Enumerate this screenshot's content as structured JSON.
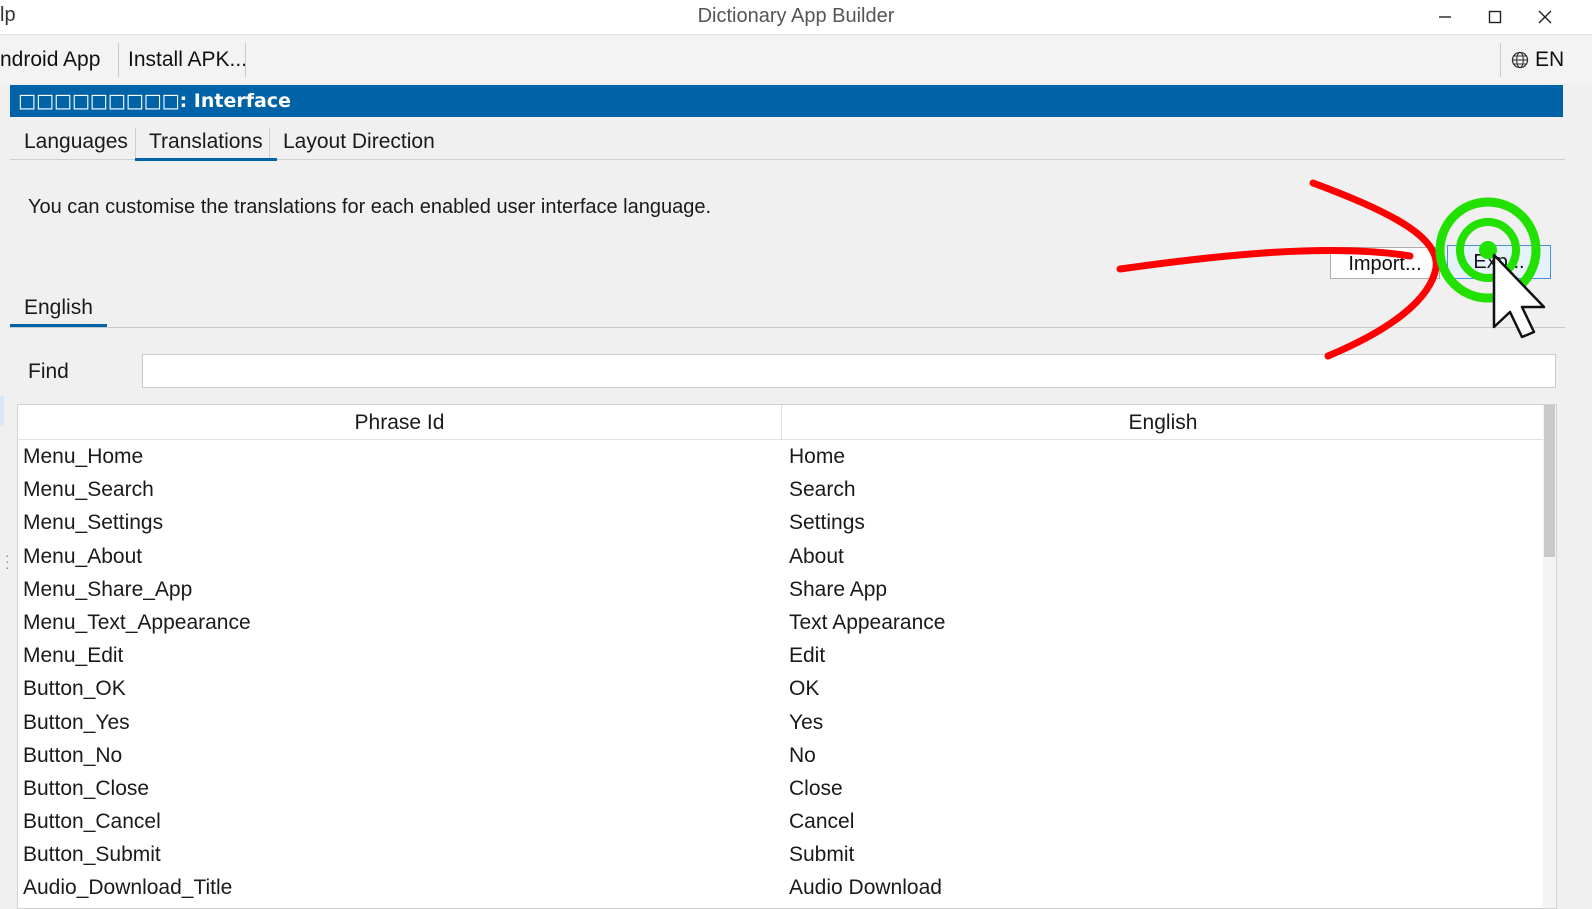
{
  "window": {
    "title": "Dictionary App Builder",
    "left_clipped_text": "lp",
    "minimize_glyph": "—",
    "maximize_glyph": "☐",
    "close_glyph": "✕"
  },
  "toolbar": {
    "build_label": "ndroid App",
    "install_label": "Install APK...",
    "language_icon": "globe-icon",
    "language_label": "EN"
  },
  "panel": {
    "header": "□□□□□□□□□: Interface"
  },
  "tabs": [
    {
      "label": "Languages"
    },
    {
      "label": "Translations",
      "active": true
    },
    {
      "label": "Layout Direction"
    }
  ],
  "translations": {
    "description": "You can customise the translations for each enabled user interface language.",
    "import_label": "Import...",
    "export_label": "Exp...",
    "language_tab": "English",
    "find_label": "Find",
    "find_value": ""
  },
  "table": {
    "columns": [
      "Phrase Id",
      "English"
    ],
    "rows": [
      [
        "Menu_Home",
        "Home"
      ],
      [
        "Menu_Search",
        "Search"
      ],
      [
        "Menu_Settings",
        "Settings"
      ],
      [
        "Menu_About",
        "About"
      ],
      [
        "Menu_Share_App",
        "Share App"
      ],
      [
        "Menu_Text_Appearance",
        "Text Appearance"
      ],
      [
        "Menu_Edit",
        "Edit"
      ],
      [
        "Button_OK",
        "OK"
      ],
      [
        "Button_Yes",
        "Yes"
      ],
      [
        "Button_No",
        "No"
      ],
      [
        "Button_Close",
        "Close"
      ],
      [
        "Button_Cancel",
        "Cancel"
      ],
      [
        "Button_Submit",
        "Submit"
      ],
      [
        "Audio_Download_Title",
        "Audio Download"
      ]
    ]
  },
  "colors": {
    "header_bg": "#0063a7",
    "annotation_arrow": "#ff0000",
    "click_highlight": "#22e000"
  }
}
